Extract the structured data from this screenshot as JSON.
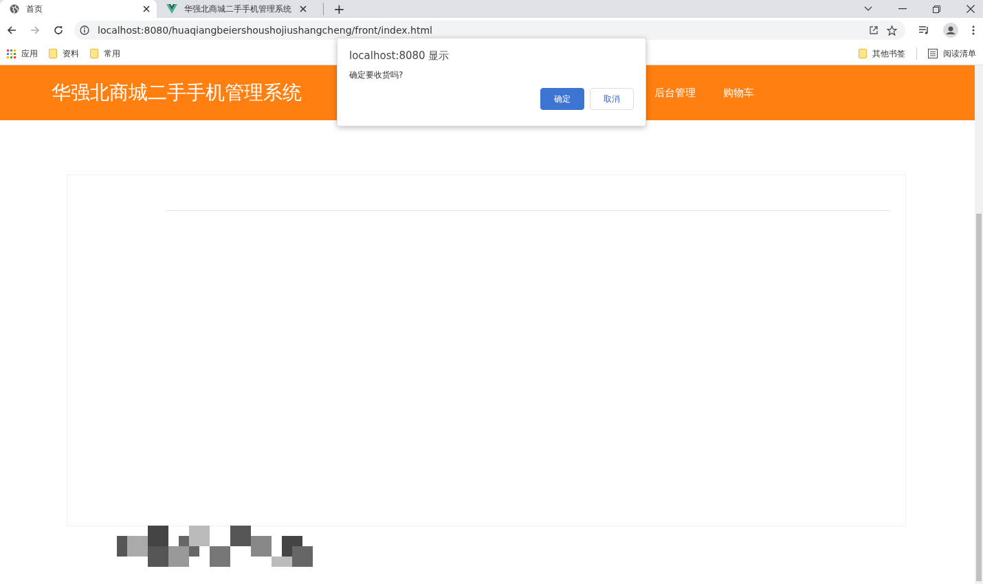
{
  "browser": {
    "tabs": [
      {
        "title": "首页",
        "selected": true,
        "kind": "globe"
      },
      {
        "title": "华强北商城二手手机管理系统",
        "selected": false,
        "kind": "vue"
      }
    ],
    "new_tab": "+",
    "url": "localhost:8080/huaqiangbeiershoushojiushangcheng/front/index.html",
    "bookmarks": [
      {
        "label": "应用",
        "kind": "apps"
      },
      {
        "label": "资料",
        "kind": "folder"
      },
      {
        "label": "常用",
        "kind": "folder"
      }
    ],
    "bookmarks_right": [
      {
        "label": "其他书签",
        "kind": "folder"
      },
      {
        "label": "阅读清单",
        "kind": "list"
      }
    ]
  },
  "site": {
    "title": "华强北商城二手手机管理系统",
    "nav": [
      {
        "label": "后台管理"
      },
      {
        "label": "购物车"
      }
    ]
  },
  "dialog": {
    "title": "localhost:8080 显示",
    "message": "确定要收货吗?",
    "buttons": [
      {
        "label": "确定",
        "selected": true
      },
      {
        "label": "取消",
        "selected": false
      }
    ]
  }
}
